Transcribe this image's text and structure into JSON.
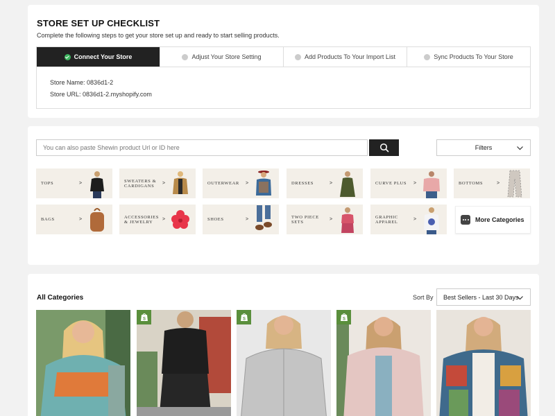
{
  "checklist": {
    "title": "STORE SET UP CHECKLIST",
    "subtitle": "Complete the following steps to get your store set up and ready to start selling products.",
    "steps": [
      {
        "label": "Connect Your Store",
        "active": true
      },
      {
        "label": "Adjust Your Store Setting",
        "active": false
      },
      {
        "label": "Add Products To Your Import List",
        "active": false
      },
      {
        "label": "Sync Products To Your Store",
        "active": false
      }
    ],
    "store_name_label": "Store Name:",
    "store_name": "0836d1-2",
    "store_url_label": "Store URL:",
    "store_url": "0836d1-2.myshopify.com"
  },
  "search": {
    "placeholder": "You can also paste Shewin product Url or ID here",
    "filters_label": "Filters"
  },
  "categories": [
    {
      "label": "TOPS",
      "arrow": ">"
    },
    {
      "label": "SWEATERS & CARDIGANS",
      "arrow": ">"
    },
    {
      "label": "OUTERWEAR",
      "arrow": ">"
    },
    {
      "label": "DRESSES",
      "arrow": ">"
    },
    {
      "label": "CURVE PLUS",
      "arrow": ">"
    },
    {
      "label": "BOTTOMS",
      "arrow": ">"
    },
    {
      "label": "BAGS",
      "arrow": ">"
    },
    {
      "label": "ACCESSORIES & JEWELRY",
      "arrow": ">"
    },
    {
      "label": "SHOES",
      "arrow": ">"
    },
    {
      "label": "TWO PIECE SETS",
      "arrow": ">"
    },
    {
      "label": "GRAPHIC APPAREL",
      "arrow": ">"
    }
  ],
  "more_categories": "More Categories",
  "products": {
    "title": "All Categories",
    "sort_label": "Sort By",
    "sort_value": "Best Sellers - Last 30 Days"
  },
  "colors": {
    "accent_dark": "#222222",
    "step_done": "#3cb55e",
    "shopify_badge": "#5a8f3c",
    "category_bg": "#f3efe8"
  }
}
